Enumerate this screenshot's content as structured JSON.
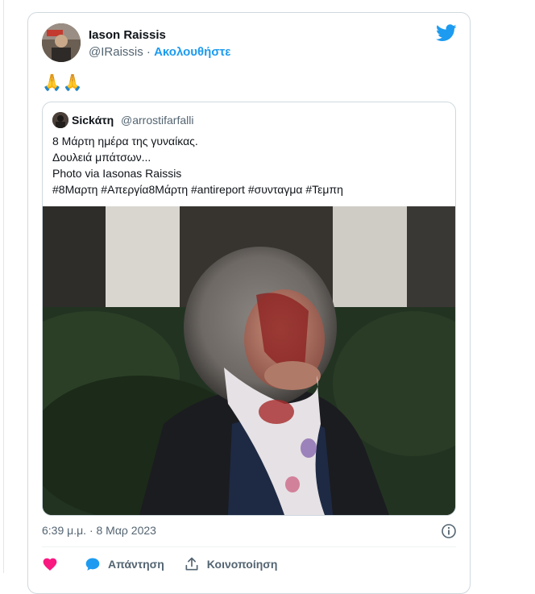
{
  "tweet": {
    "author_name": "Iason Raissis",
    "author_handle": "@IRaissis",
    "separator": " · ",
    "follow_label": "Ακολουθήστε",
    "text": "🙏🙏",
    "timestamp": "6:39 μ.μ. · 8 Μαρ 2023",
    "reply_label": "Απάντηση",
    "share_label": "Κοινοποίηση"
  },
  "quoted": {
    "author_name": "Sickάτη",
    "author_handle": "@arrostifarfalli",
    "lines": [
      "8 Μάρτη ημέρα της γυναίκας.",
      "Δουλειά μπάτσων...",
      "Photo via Iasonas Raissis",
      "#8Μαρτη #Απεργία8Μάρτη #antireport #συνταγμα #Τεμπη"
    ]
  },
  "icons": {
    "platform": "twitter-bird-icon",
    "like": "heart-icon",
    "reply": "speech-bubble-icon",
    "share": "share-upload-icon",
    "info": "info-icon"
  },
  "colors": {
    "accent": "#1d9bf0",
    "like": "#f91880",
    "text": "#0f1419",
    "muted": "#536471",
    "border": "#cfd9de"
  }
}
